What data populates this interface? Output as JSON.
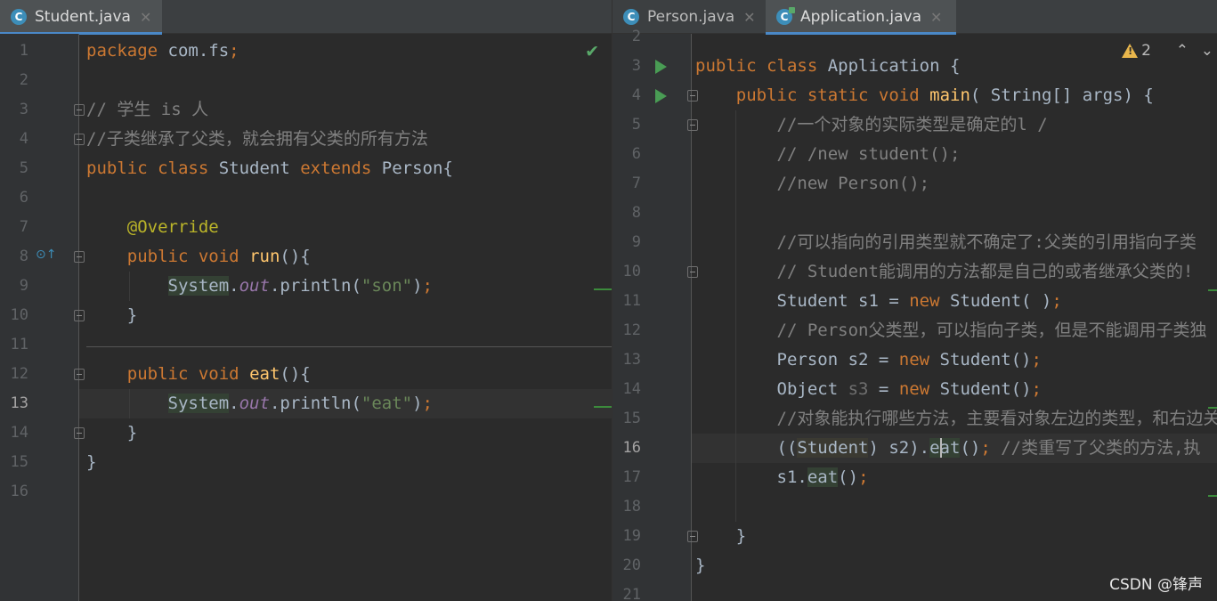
{
  "left": {
    "tab": {
      "label": "Student.java",
      "icon": "java-class-icon"
    },
    "lines": [
      {
        "n": "1",
        "html": "<span class=\"kw\">package</span> com.fs<span class=\"kw\">;</span>"
      },
      {
        "n": "2",
        "html": ""
      },
      {
        "n": "3",
        "html": "<span class=\"cm\">// 学生 is 人</span>"
      },
      {
        "n": "4",
        "html": "<span class=\"cm\">//子类继承了父类，就会拥有父类的所有方法</span>"
      },
      {
        "n": "5",
        "html": "<span class=\"kw\">public class</span> Student <span class=\"kw\">extends</span> Person{"
      },
      {
        "n": "6",
        "html": ""
      },
      {
        "n": "7",
        "html": "    <span class=\"an\">@Override</span>"
      },
      {
        "n": "8",
        "html": "    <span class=\"kw\">public void</span> <span class=\"fn\">run</span>(){"
      },
      {
        "n": "9",
        "html": "        <span class=\"bg-sys\">System</span>.<span class=\"it\">out</span>.println(<span class=\"str\">\"son\"</span>)<span class=\"kw\">;</span>"
      },
      {
        "n": "10",
        "html": "    }"
      },
      {
        "n": "11",
        "html": ""
      },
      {
        "n": "12",
        "html": "    <span class=\"kw\">public void</span> <span class=\"fn\">eat</span>(){"
      },
      {
        "n": "13",
        "html": "        <span class=\"bg-sys\">System</span>.<span class=\"it\">out</span>.println(<span class=\"str\">\"eat\"</span>)<span class=\"kw\">;</span>"
      },
      {
        "n": "14",
        "html": "    }"
      },
      {
        "n": "15",
        "html": "}"
      },
      {
        "n": "16",
        "html": ""
      }
    ]
  },
  "right": {
    "tabs": [
      {
        "label": "Person.java",
        "icon": "java-class-icon"
      },
      {
        "label": "Application.java",
        "icon": "java-runnable-class-icon"
      }
    ],
    "warnings": {
      "count": "2"
    },
    "lines": [
      {
        "n": "2",
        "html": ""
      },
      {
        "n": "3",
        "html": "<span class=\"kw\">public class</span> Application {"
      },
      {
        "n": "4",
        "html": "    <span class=\"kw\">public static void</span> <span class=\"fn\">main</span>( String[] args) {"
      },
      {
        "n": "5",
        "html": "        <span class=\"cm\">//一个对象的实际类型是确定的l /</span>"
      },
      {
        "n": "6",
        "html": "        <span class=\"cm\">// /new student();</span>"
      },
      {
        "n": "7",
        "html": "        <span class=\"cm\">//new Person();</span>"
      },
      {
        "n": "8",
        "html": ""
      },
      {
        "n": "9",
        "html": "        <span class=\"cm\">//可以指向的引用类型就不确定了:父类的引用指向子类</span>"
      },
      {
        "n": "10",
        "html": "        <span class=\"cm\">// Student能调用的方法都是自己的或者继承父类的!</span>"
      },
      {
        "n": "11",
        "html": "        Student s1 = <span class=\"kw\">new</span> Student( )<span class=\"kw\">;</span>"
      },
      {
        "n": "12",
        "html": "        <span class=\"cm\">// Person父类型，可以指向子类，但是不能调用子类独</span>"
      },
      {
        "n": "13",
        "html": "        Person s2 = <span class=\"kw\">new</span> Student()<span class=\"kw\">;</span>"
      },
      {
        "n": "14",
        "html": "        Object <span class=\"unused\">s3</span> = <span class=\"kw\">new</span> Student()<span class=\"kw\">;</span>"
      },
      {
        "n": "15",
        "html": "        <span class=\"cm\">//对象能执行哪些方法，主要看对象左边的类型，和右边关</span>"
      },
      {
        "n": "16",
        "html": "        ((<span class=\"bg-cast\">Student</span>) s2).<span class=\"bg-sys\">eat</span>()<span class=\"kw\">;</span> <span class=\"cm\">//类重写了父类的方法,执</span>"
      },
      {
        "n": "17",
        "html": "        s1.<span class=\"bg-sys\">eat</span>()<span class=\"kw\">;</span>"
      },
      {
        "n": "18",
        "html": ""
      },
      {
        "n": "19",
        "html": "    }"
      },
      {
        "n": "20",
        "html": "}"
      },
      {
        "n": "21",
        "html": ""
      }
    ]
  },
  "watermark": "CSDN @锋声",
  "colors": {
    "keyword": "#cc7832",
    "comment": "#808080",
    "string": "#6a8759",
    "annotation": "#bbb529",
    "method": "#ffc66d",
    "accent": "#4a88c7"
  }
}
